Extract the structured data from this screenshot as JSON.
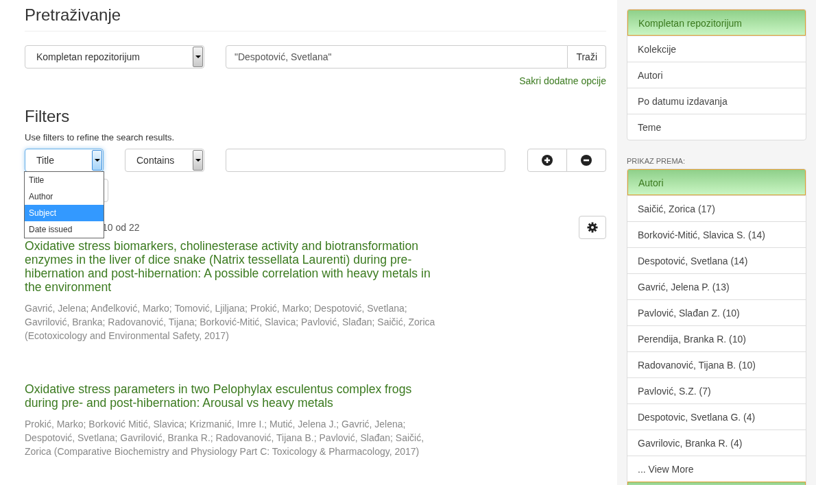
{
  "page_title": "Pretraživanje",
  "scope_select": {
    "value": "Kompletan repozitorijum"
  },
  "search": {
    "value": "\"Despotović, Svetlana\"",
    "button": "Traži"
  },
  "options_link": "Sakri dodatne opcije",
  "filters": {
    "heading": "Filters",
    "hint": "Use filters to refine the search results.",
    "field_select": {
      "value": "Title",
      "expanded": true,
      "options": [
        {
          "label": "Title",
          "highlighted": false
        },
        {
          "label": "Author",
          "highlighted": false
        },
        {
          "label": "Subject",
          "highlighted": true
        },
        {
          "label": "Date issued",
          "highlighted": false
        }
      ]
    },
    "operator_select": {
      "value": "Contains"
    }
  },
  "results": {
    "count_text": "10 od 22",
    "items": [
      {
        "title": "Oxidative stress biomarkers, cholinesterase activity and biotransformation enzymes in the liver of dice snake (Natrix tessellata Laurenti) during pre-hibernation and post-hibernation: A possible correlation with heavy metals in the environment",
        "authors": "Gavrić, Jelena; Anđelković, Marko; Tomović, Ljiljana; Prokić, Marko; Despotović, Svetlana; Gavrilović, Branka; Radovanović, Tijana; Borković-Mitić, Slavica; Pavlović, Slađan; Saičić, Zorica",
        "source": "(Ecotoxicology and Environmental Safety, 2017)"
      },
      {
        "title": "Oxidative stress parameters in two Pelophylax esculentus complex frogs during pre- and post-hibernation: Arousal vs heavy metals",
        "authors": "Prokić, Marko; Borković Mitić, Slavica; Krizmanić, Imre I.; Mutić, Jelena J.; Gavrić, Jelena; Despotović, Svetlana; Gavrilović, Branka R.; Radovanović, Tijana B.; Pavlović, Slađan; Saičić, Zorica",
        "source": "(Comparative Biochemistry and Physiology Part C: Toxicology & Pharmacology, 2017)"
      }
    ]
  },
  "sidebar": {
    "nav": [
      {
        "label": "Kompletan repozitorijum",
        "selected": true
      },
      {
        "label": "Kolekcije",
        "selected": false
      },
      {
        "label": "Autori",
        "selected": false
      },
      {
        "label": "Po datumu izdavanja",
        "selected": false
      },
      {
        "label": "Teme",
        "selected": false
      }
    ],
    "browse_heading": "PRIKAZ PREMA:",
    "browse_panel": {
      "heading": "Autori",
      "items": [
        "Saičić, Zorica (17)",
        "Borković-Mitić, Slavica S. (14)",
        "Despotović, Svetlana (14)",
        "Gavrić, Jelena P. (13)",
        "Pavlović, Slađan Z. (10)",
        "Perendija, Branka R. (10)",
        "Radovanović, Tijana B. (10)",
        "Pavlović, S.Z. (7)",
        "Despotovic, Svetlana G. (4)",
        "Gavrilovic, Branka R. (4)"
      ],
      "view_more": "... View More"
    }
  }
}
